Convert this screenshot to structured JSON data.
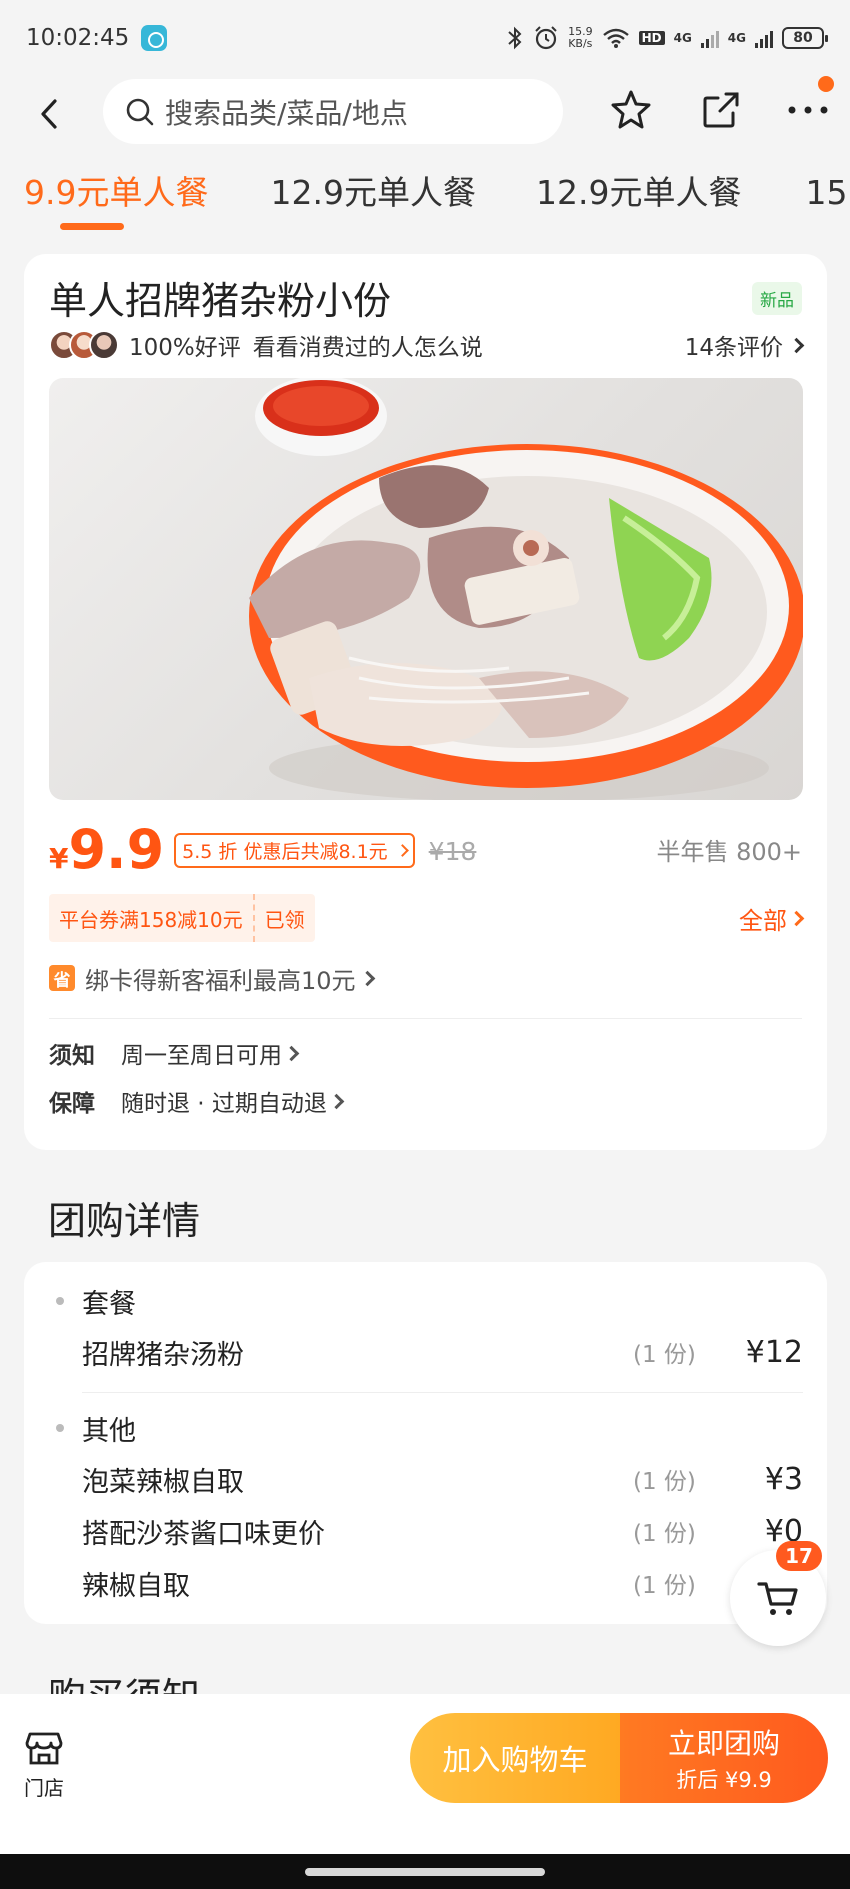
{
  "status_bar": {
    "time": "10:02:45",
    "net_speed_value": "15.9",
    "net_speed_unit": "KB/s",
    "hd_label": "HD",
    "signal1": "4G",
    "signal2": "4G",
    "battery": "80"
  },
  "search": {
    "placeholder": "搜索品类/菜品/地点"
  },
  "tabs": [
    {
      "label": "9.9元单人餐"
    },
    {
      "label": "12.9元单人餐"
    },
    {
      "label": "12.9元单人餐"
    },
    {
      "label": "15"
    }
  ],
  "product": {
    "title": "单人招牌猪杂粉小份",
    "badge": "新品",
    "rating_text": "100%好评",
    "review_prompt": "看看消费过的人怎么说",
    "review_count": "14条评价",
    "currency": "¥",
    "price": "9.9",
    "discount_tag": "5.5 折 优惠后共减8.1元",
    "original_price": "¥18",
    "sold": "半年售 800+",
    "coupon_text": "平台券满158减10元",
    "coupon_status": "已领",
    "all_link": "全部",
    "card_offer_icon": "省",
    "card_offer": "绑卡得新客福利最高10元",
    "notice_label": "须知",
    "notice_value": "周一至周日可用",
    "guarantee_label": "保障",
    "guarantee_value": "随时退 · 过期自动退"
  },
  "section_title": "团购详情",
  "details": {
    "groups": [
      {
        "name": "套餐",
        "items": [
          {
            "name": "招牌猪杂汤粉",
            "qty": "(1 份)",
            "price": "¥12"
          }
        ]
      },
      {
        "name": "其他",
        "items": [
          {
            "name": "泡菜辣椒自取",
            "qty": "(1 份)",
            "price": "¥3"
          },
          {
            "name": "搭配沙茶酱口味更价",
            "qty": "(1 份)",
            "price": "¥0"
          },
          {
            "name": "辣椒自取",
            "qty": "(1 份)",
            "price": ""
          }
        ]
      }
    ]
  },
  "cart_count": "17",
  "next_section_title": "购买须知",
  "bottom": {
    "store_label": "门店",
    "add_cart": "加入购物车",
    "buy_now": "立即团购",
    "buy_now_sub": "折后 ¥9.9"
  },
  "colors": {
    "accent": "#ff5512",
    "accent_light": "#ff6a1a",
    "cart_btn": "#ffa922",
    "new_badge": "#27a844"
  },
  "icons": [
    "back-arrow-icon",
    "search-icon",
    "star-icon",
    "share-icon",
    "more-icon",
    "cart-icon",
    "store-icon",
    "bluetooth-icon",
    "alarm-icon",
    "wifi-icon"
  ]
}
